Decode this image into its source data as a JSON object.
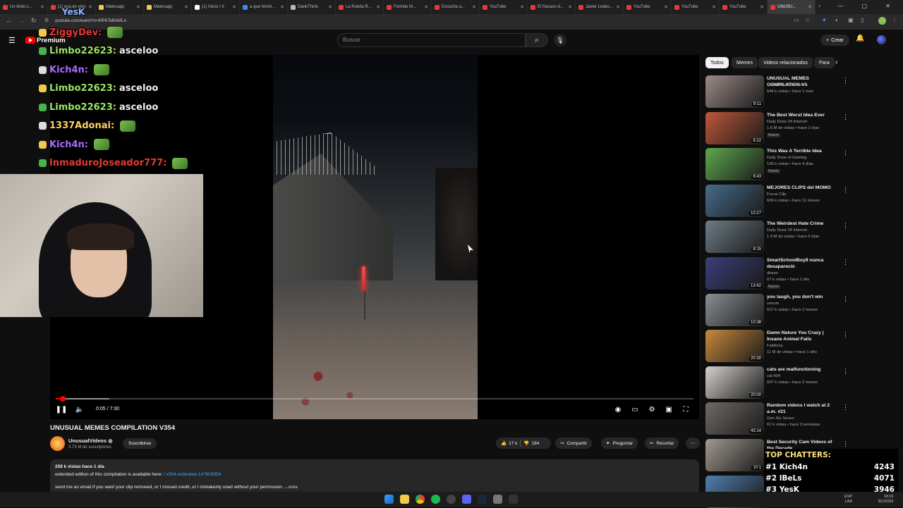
{
  "browser": {
    "tabs": [
      {
        "label": "Un lindo c...",
        "color": "#e53935"
      },
      {
        "label": "(1) eca en vivo",
        "color": "#e53935"
      },
      {
        "label": "Matecapp",
        "color": "#f2c94c"
      },
      {
        "label": "Matecapp",
        "color": "#f2c94c"
      },
      {
        "label": "(1) Inicio / X",
        "color": "#ffffff"
      },
      {
        "label": "a que hinch...",
        "color": "#4285f4"
      },
      {
        "label": "DankThink",
        "color": "#bbbbbb"
      },
      {
        "label": "La Ruleta R...",
        "color": "#e53935"
      },
      {
        "label": "Fortnite M...",
        "color": "#e53935"
      },
      {
        "label": "Escucha a...",
        "color": "#e53935"
      },
      {
        "label": "YouTube",
        "color": "#e53935"
      },
      {
        "label": "El fracaso d...",
        "color": "#e53935"
      },
      {
        "label": "Javier Ledes...",
        "color": "#e53935"
      },
      {
        "label": "YouTube",
        "color": "#e53935"
      },
      {
        "label": "YouTube",
        "color": "#e53935"
      },
      {
        "label": "YouTube",
        "color": "#e53935"
      },
      {
        "label": "UNUSU...",
        "color": "#e53935",
        "active": true
      }
    ],
    "new_tab": "+",
    "url": "youtube.com/watch?v=f0PKTeBAMLA"
  },
  "youtube": {
    "logo_text": "Premium",
    "search_placeholder": "Buscar",
    "create_label": "Crear"
  },
  "chat": [
    {
      "user": "ZiggyDev:",
      "message": "",
      "color": "#e53935"
    },
    {
      "user": "Limbo22623:",
      "message": "asceloo",
      "color": "#9be564"
    },
    {
      "user": "Kich4n:",
      "message": "",
      "color": "#a66bff"
    },
    {
      "user": "Limbo22623:",
      "message": "asceloo",
      "color": "#9be564"
    },
    {
      "user": "Limbo22623:",
      "message": "asceloo",
      "color": "#9be564"
    },
    {
      "user": "1337Adonai:",
      "message": "",
      "color": "#ffd166"
    },
    {
      "user": "Kich4n:",
      "message": "",
      "color": "#a66bff"
    },
    {
      "user": "InmaduroJoseador777:",
      "message": "",
      "color": "#e53935"
    }
  ],
  "overlay_name": "YesK",
  "player": {
    "time_current": "0:05",
    "time_total": "7:30",
    "progress": 0.011
  },
  "video": {
    "title": "UNUSUAL MEMES COMPILATION V354",
    "channel": "UnusualVideos",
    "subscribers": "3.73 M de suscriptores",
    "subscribe_label": "Suscribirse",
    "likes": "17 k",
    "dislikes": "184",
    "share_label": "Compartir",
    "ask_label": "Preguntar",
    "clip_label": "Recortar",
    "description_line1": "259 k vistas  hace 1 día",
    "description_line2_prefix": "extended edition of this compilation is available here:",
    "description_line2_link": "/ v354-extended-147605954",
    "description_line3": "send me an email if you want your clip removed, or I missed credit, or I mistakenly used without your permission.",
    "description_more": "...más"
  },
  "sidebar": {
    "chips": [
      "Todos",
      "Memes",
      "Videos relacionados",
      "Para"
    ],
    "items": [
      {
        "title": "UNUSUAL MEMES COMPILATION V1",
        "channel": "Unusual Videos Meme",
        "views": "544 k vistas • hace 1 mes",
        "duration": "9:11",
        "new": "",
        "thumb": "#9c8b88"
      },
      {
        "title": "The Best Worst Idea Ever",
        "channel": "Daily Dose Of Internet",
        "views": "1.6 M de vistas • hace 3 días",
        "duration": "8:22",
        "new": "Nuevo",
        "thumb": "#c0573a"
      },
      {
        "title": "This Was A Terrible Idea",
        "channel": "Daily Dose of Gaming",
        "views": "196 k vistas • hace 4 días",
        "duration": "8:43",
        "new": "Nuevo",
        "thumb": "#5ea84e"
      },
      {
        "title": "MEJORES CLIPS del MOMO",
        "channel": "Focus Clip",
        "views": "606 k vistas • hace 11 meses",
        "duration": "10:27",
        "new": "",
        "thumb": "#476c8a"
      },
      {
        "title": "The Weirdest Hate Crime",
        "channel": "Daily Dose Of Internet",
        "views": "1.9 M de vistas • hace 9 días",
        "duration": "8:15",
        "new": "",
        "thumb": "#6e7d86"
      },
      {
        "title": "SmartSchoolBoy9 nunca desapareció",
        "channel": "dioren",
        "views": "67 k vistas • hace 1 día",
        "duration": "13:42",
        "new": "Nuevo",
        "thumb": "#3b3f7a"
      },
      {
        "title": "you laugh, you don't win",
        "channel": "venom",
        "views": "617 k vistas • hace 2 meses",
        "duration": "10:38",
        "new": "",
        "thumb": "#8b8f95"
      },
      {
        "title": "Damn Nature You Crazy | Insane Animal Fails",
        "channel": "FailArmy",
        "views": "11 M de vistas • hace 1 año",
        "duration": "20:30",
        "new": "",
        "thumb": "#c9893c"
      },
      {
        "title": "cats are malfunctioning",
        "channel": "cat.404",
        "views": "607 k vistas • hace 2 meses",
        "duration": "20:00",
        "new": "",
        "thumb": "#d6d2cc"
      },
      {
        "title": "Random videos I watch at 2 a.m. #21",
        "channel": "Gen Six Seven",
        "views": "61 k vistas • hace 3 semanas",
        "duration": "43:14",
        "new": "",
        "thumb": "#6f6a66"
      },
      {
        "title": "Best Security Cam Videos of the Decade",
        "channel": "",
        "views": "",
        "duration": "10:1",
        "new": "",
        "thumb": "#a29a92"
      },
      {
        "title": "",
        "channel": "",
        "views": "",
        "duration": "",
        "new": "",
        "thumb": "#4f7fb0"
      }
    ]
  },
  "top_chatters": {
    "title": "TOP CHATTERS:",
    "rows": [
      {
        "rank": "#1",
        "name": "Kich4n",
        "count": "4243"
      },
      {
        "rank": "#2",
        "name": "lBeLs",
        "count": "4071"
      },
      {
        "rank": "#3",
        "name": "YesK",
        "count": "3946"
      }
    ]
  },
  "taskbar": {
    "lang1": "ESP",
    "lang2": "LAA",
    "time": "18:15",
    "date": "8/1/2025"
  }
}
